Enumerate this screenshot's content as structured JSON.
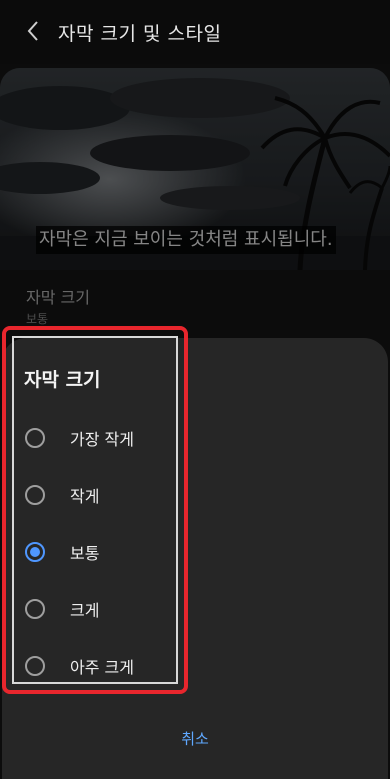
{
  "header": {
    "title": "자막 크기 및 스타일"
  },
  "preview": {
    "caption": "자막은 지금 보이는 것처럼 표시됩니다."
  },
  "setting": {
    "label": "자막 크기",
    "value": "보통"
  },
  "dialog": {
    "title": "자막 크기",
    "options": [
      {
        "label": "가장 작게",
        "selected": false
      },
      {
        "label": "작게",
        "selected": false
      },
      {
        "label": "보통",
        "selected": true
      },
      {
        "label": "크게",
        "selected": false
      },
      {
        "label": "아주 크게",
        "selected": false
      }
    ],
    "cancel_label": "취소"
  },
  "colors": {
    "accent": "#4f97ff",
    "highlight": "#e8262d"
  }
}
